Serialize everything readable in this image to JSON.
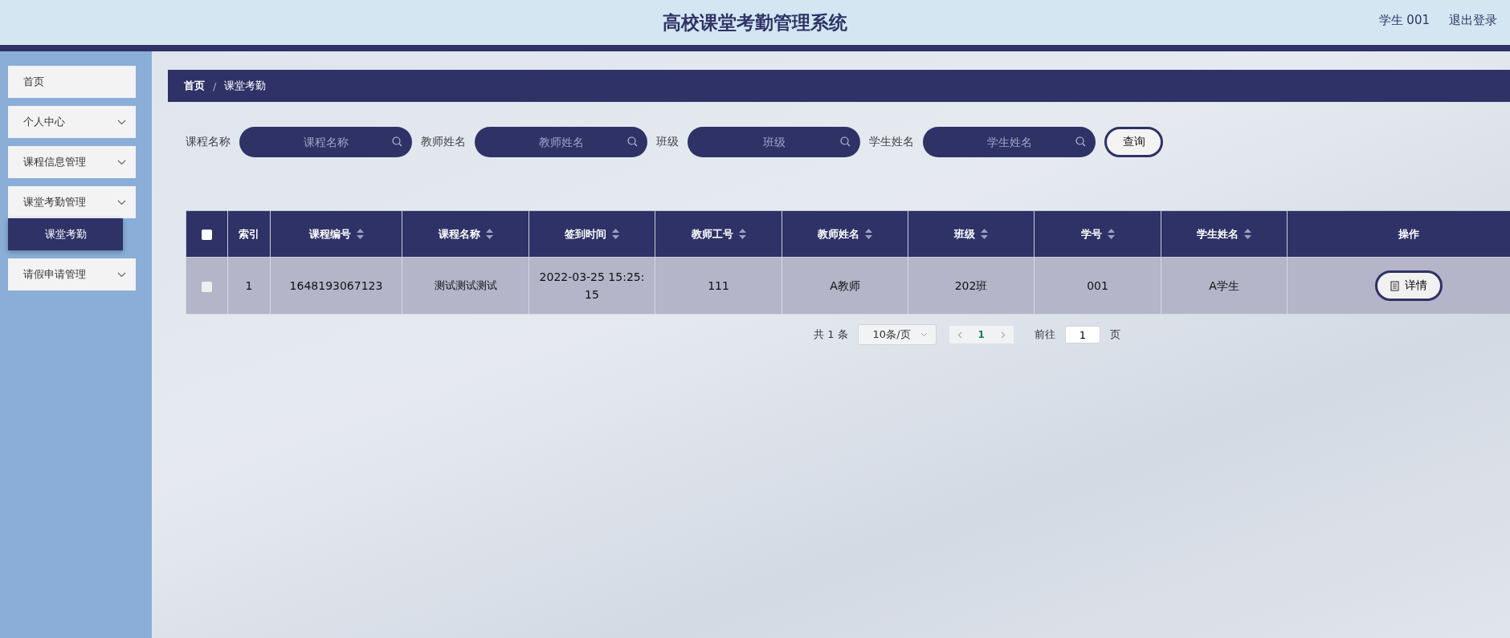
{
  "header": {
    "title": "高校课堂考勤管理系统",
    "user": "学生 001",
    "logout": "退出登录"
  },
  "sidebar": {
    "items": [
      {
        "label": "首页",
        "kind": "link"
      },
      {
        "label": "个人中心",
        "kind": "submenu"
      },
      {
        "label": "课程信息管理",
        "kind": "submenu"
      },
      {
        "label": "课堂考勤管理",
        "kind": "submenu",
        "expanded": true,
        "children": [
          {
            "label": "课堂考勤",
            "selected": true
          }
        ]
      },
      {
        "label": "请假申请管理",
        "kind": "submenu"
      }
    ]
  },
  "breadcrumb": {
    "separator": "/",
    "items": [
      "首页",
      "课堂考勤"
    ]
  },
  "search": {
    "fields": [
      {
        "label": "课程名称",
        "placeholder": "课程名称"
      },
      {
        "label": "教师姓名",
        "placeholder": "教师姓名"
      },
      {
        "label": "班级",
        "placeholder": "班级"
      },
      {
        "label": "学生姓名",
        "placeholder": "学生姓名"
      }
    ],
    "button": "查询"
  },
  "table": {
    "select_all_checked": false,
    "columns": [
      {
        "label": "索引",
        "sortable": false
      },
      {
        "label": "课程编号",
        "sortable": true
      },
      {
        "label": "课程名称",
        "sortable": true
      },
      {
        "label": "签到时间",
        "sortable": true
      },
      {
        "label": "教师工号",
        "sortable": true
      },
      {
        "label": "教师姓名",
        "sortable": true
      },
      {
        "label": "班级",
        "sortable": true
      },
      {
        "label": "学号",
        "sortable": true
      },
      {
        "label": "学生姓名",
        "sortable": true
      },
      {
        "label": "操作",
        "sortable": false
      }
    ],
    "rows": [
      {
        "checked": false,
        "cells": [
          "1",
          "1648193067123",
          "测试测试测试",
          "2022-03-25 15:25:15",
          "111",
          "A教师",
          "202班",
          "001",
          "A学生"
        ],
        "action": "详情"
      }
    ]
  },
  "pagination": {
    "total": "共 1 条",
    "page_size": "10条/页",
    "current_page": "1",
    "goto_label": "前往",
    "goto_value": "1",
    "goto_suffix": "页"
  }
}
